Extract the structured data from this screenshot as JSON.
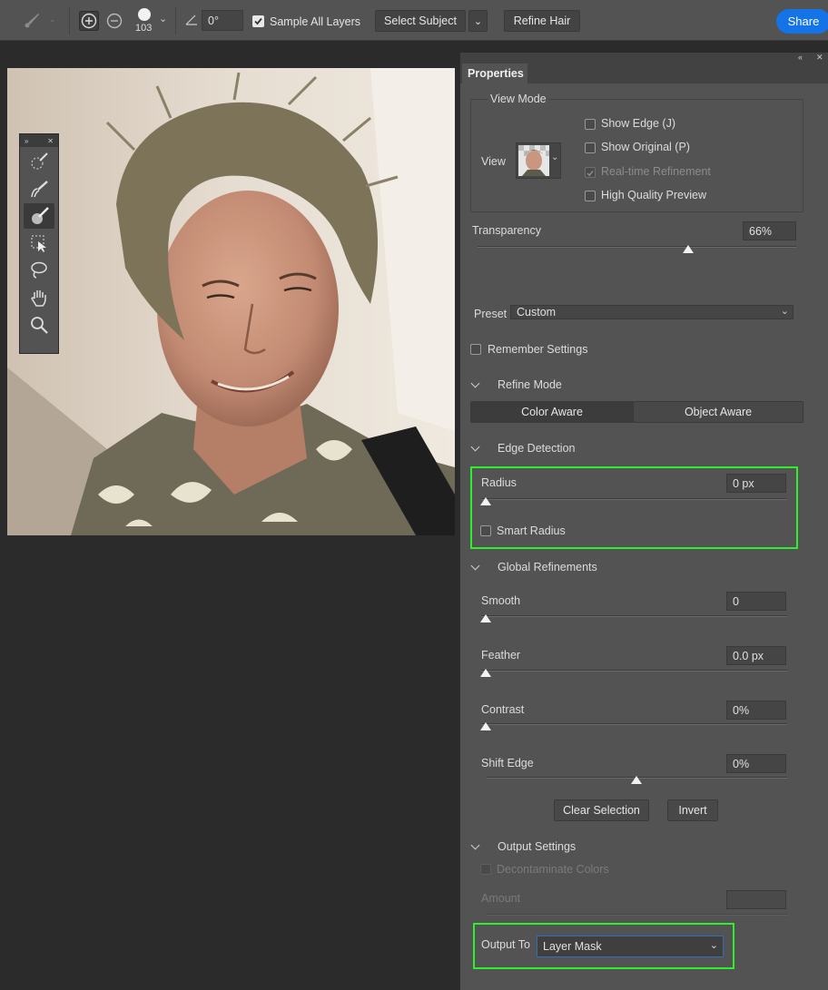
{
  "toolbar": {
    "brush_size": "103",
    "angle": "0°",
    "sample_all_layers": "Sample All Layers",
    "select_subject": "Select Subject",
    "refine_hair": "Refine Hair",
    "share": "Share"
  },
  "properties": {
    "tab": "Properties",
    "view_mode": {
      "title": "View Mode",
      "view_label": "View",
      "show_edge": "Show Edge (J)",
      "show_original": "Show Original (P)",
      "realtime": "Real-time Refinement",
      "hq_preview": "High Quality Preview"
    },
    "transparency": {
      "label": "Transparency",
      "value": "66%",
      "level": 0.66
    },
    "preset": {
      "label": "Preset",
      "value": "Custom"
    },
    "remember": "Remember Settings",
    "refine_mode": {
      "title": "Refine Mode",
      "color_aware": "Color Aware",
      "object_aware": "Object Aware"
    },
    "edge_detection": {
      "title": "Edge Detection",
      "radius_label": "Radius",
      "radius_value": "0 px",
      "smart_radius": "Smart Radius"
    },
    "global_refinements": {
      "title": "Global Refinements",
      "smooth": {
        "label": "Smooth",
        "value": "0"
      },
      "feather": {
        "label": "Feather",
        "value": "0.0 px"
      },
      "contrast": {
        "label": "Contrast",
        "value": "0%"
      },
      "shift_edge": {
        "label": "Shift Edge",
        "value": "0%"
      }
    },
    "clear_selection": "Clear Selection",
    "invert": "Invert",
    "output_settings": {
      "title": "Output Settings",
      "decontaminate": "Decontaminate Colors",
      "amount": "Amount",
      "output_to_label": "Output To",
      "output_to_value": "Layer Mask"
    }
  },
  "colors": {
    "highlight": "#2cf02c",
    "accent": "#1473e6",
    "panel": "#535353"
  }
}
